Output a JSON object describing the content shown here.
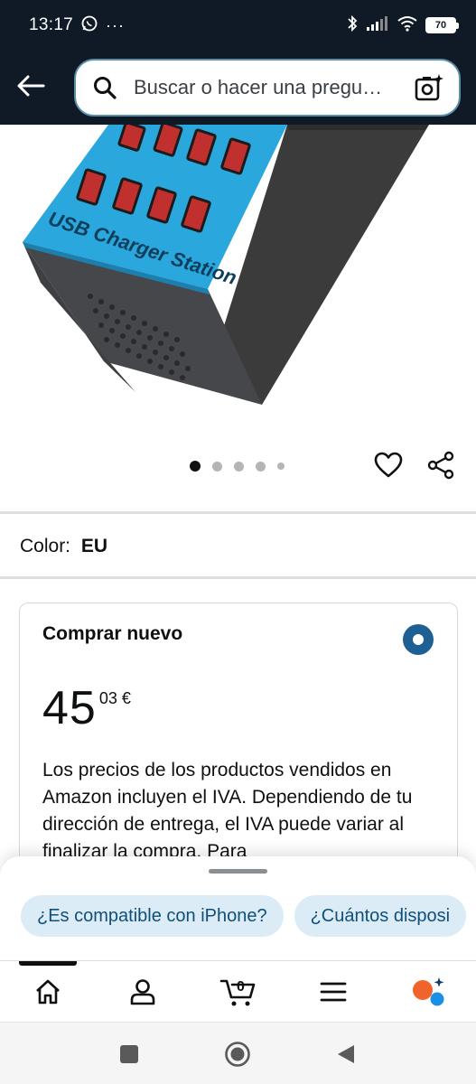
{
  "status_bar": {
    "time": "13:17",
    "battery": "70",
    "icons": [
      "whatsapp-icon",
      "more-notifications-icon",
      "bluetooth-icon",
      "signal-icon",
      "wifi-icon",
      "battery-icon"
    ]
  },
  "header": {
    "search_placeholder": "Buscar o hacer una pregu…",
    "icons": [
      "back-arrow-icon",
      "search-icon",
      "camera-lens-icon"
    ]
  },
  "product_image": {
    "label_text": "USB Charger Station",
    "accent_color": "#2aa7dc"
  },
  "carousel": {
    "total_dots": 5,
    "active_index": 0
  },
  "color_selector": {
    "label": "Color:",
    "value": "EU"
  },
  "buy_box": {
    "title": "Comprar nuevo",
    "price_whole": "45",
    "price_fraction": "03 €",
    "vat_text": "Los precios de los productos vendidos en Amazon incluyen el IVA. Dependiendo de tu dirección de entrega, el IVA puede variar al finalizar la compra. Para"
  },
  "suggestions": {
    "chips": [
      "¿Es compatible con iPhone?",
      "¿Cuántos disposi"
    ]
  },
  "bottom_nav": {
    "cart_count": "0",
    "items": [
      "home-icon",
      "account-icon",
      "cart-icon",
      "menu-icon",
      "rufus-assistant-icon"
    ]
  },
  "colors": {
    "header_bg": "#0f1a26",
    "chip_bg": "#dcecf6",
    "chip_text": "#0f4f7a",
    "radio": "#1e5f94"
  }
}
